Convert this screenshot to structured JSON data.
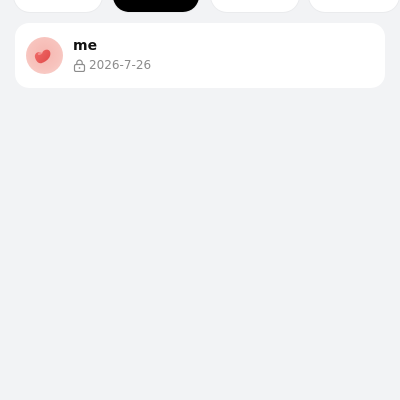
{
  "filter_pills": [
    {
      "label": "",
      "active": false
    },
    {
      "label": "",
      "active": true
    },
    {
      "label": "",
      "active": false
    },
    {
      "label": "",
      "active": false
    }
  ],
  "list": {
    "items": [
      {
        "title": "me",
        "date": "2026-7-26",
        "lock_icon": "lock-icon",
        "avatar": "red-heart-avatar"
      }
    ]
  },
  "colors": {
    "background": "#f2f3f5",
    "card": "#ffffff",
    "active_pill": "#000000",
    "title_text": "#111111",
    "meta_text": "#8c8c8c",
    "avatar_bg": "#f7c3bd",
    "heart": "#e84d4d"
  }
}
